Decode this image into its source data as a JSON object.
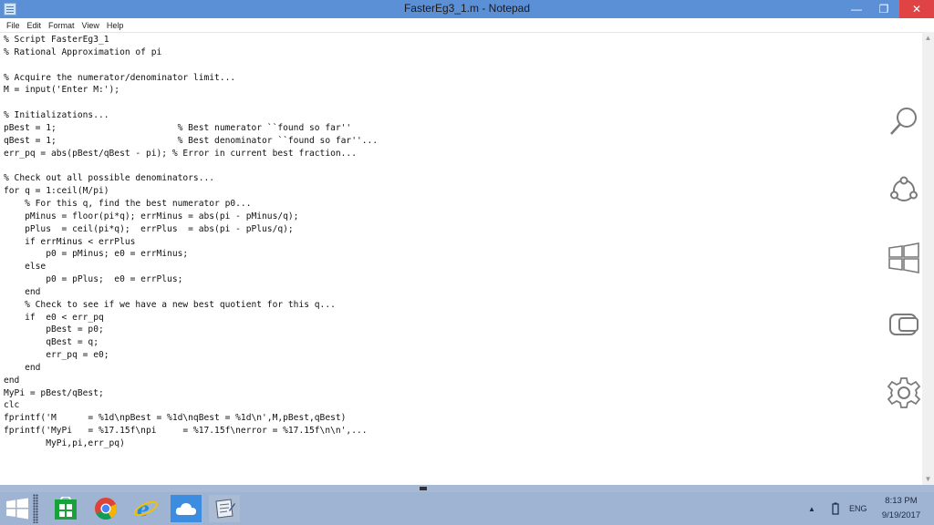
{
  "window": {
    "title": "FasterEg3_1.m - Notepad",
    "minimize_symbol": "—",
    "maximize_symbol": "❐",
    "close_symbol": "✕"
  },
  "menu": [
    "File",
    "Edit",
    "Format",
    "View",
    "Help"
  ],
  "editor": {
    "lines": [
      "% Script FasterEg3_1",
      "% Rational Approximation of pi",
      "",
      "% Acquire the numerator/denominator limit...",
      "M = input('Enter M:');",
      "",
      "% Initializations...",
      "pBest = 1;                       % Best numerator ``found so far''",
      "qBest = 1;                       % Best denominator ``found so far''...",
      "err_pq = abs(pBest/qBest - pi); % Error in current best fraction...",
      "",
      "% Check out all possible denominators...",
      "for q = 1:ceil(M/pi)",
      "    % For this q, find the best numerator p0...",
      "    pMinus = floor(pi*q); errMinus = abs(pi - pMinus/q);",
      "    pPlus  = ceil(pi*q);  errPlus  = abs(pi - pPlus/q);",
      "    if errMinus < errPlus",
      "        p0 = pMinus; e0 = errMinus;",
      "    else",
      "        p0 = pPlus;  e0 = errPlus;",
      "    end",
      "    % Check to see if we have a new best quotient for this q...",
      "    if  e0 < err_pq",
      "        pBest = p0;",
      "        qBest = q;",
      "        err_pq = e0;",
      "    end",
      "end",
      "MyPi = pBest/qBest;",
      "clc",
      "fprintf('M      = %1d\\npBest = %1d\\nqBest = %1d\\n',M,pBest,qBest)",
      "fprintf('MyPi   = %17.15f\\npi     = %17.15f\\nerror = %17.15f\\n\\n',...",
      "        MyPi,pi,err_pq)"
    ]
  },
  "charms": [
    "search-icon",
    "share-icon",
    "start-icon",
    "devices-icon",
    "settings-icon"
  ],
  "taskbar": {
    "apps": [
      "start-icon",
      "store-icon",
      "chrome-icon",
      "internet-explorer-icon",
      "onedrive-icon",
      "notepad-icon"
    ],
    "tray_arrow": "▲",
    "language": "ENG",
    "time": "8:13 PM",
    "date": "9/19/2017"
  }
}
